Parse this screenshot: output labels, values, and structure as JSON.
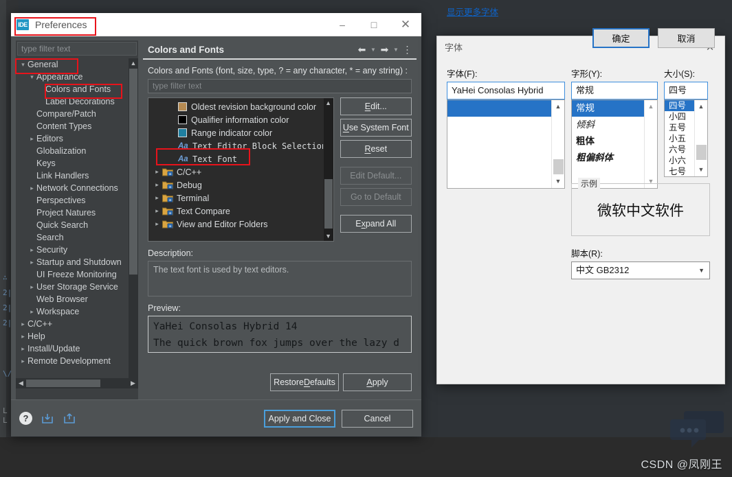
{
  "window": {
    "title": "Preferences",
    "badge": "IDE",
    "controls": {
      "minimize": "–",
      "maximize": "□",
      "close": "✕"
    }
  },
  "sidebar": {
    "filter_placeholder": "type filter text",
    "items": [
      {
        "label": "General",
        "indent": 0,
        "arrow": "down"
      },
      {
        "label": "Appearance",
        "indent": 1,
        "arrow": "down"
      },
      {
        "label": "Colors and Fonts",
        "indent": 2,
        "arrow": "none"
      },
      {
        "label": "Label Decorations",
        "indent": 2,
        "arrow": "none"
      },
      {
        "label": "Compare/Patch",
        "indent": 1,
        "arrow": "none"
      },
      {
        "label": "Content Types",
        "indent": 1,
        "arrow": "none"
      },
      {
        "label": "Editors",
        "indent": 1,
        "arrow": "right"
      },
      {
        "label": "Globalization",
        "indent": 1,
        "arrow": "none"
      },
      {
        "label": "Keys",
        "indent": 1,
        "arrow": "none"
      },
      {
        "label": "Link Handlers",
        "indent": 1,
        "arrow": "none"
      },
      {
        "label": "Network Connections",
        "indent": 1,
        "arrow": "right"
      },
      {
        "label": "Perspectives",
        "indent": 1,
        "arrow": "none"
      },
      {
        "label": "Project Natures",
        "indent": 1,
        "arrow": "none"
      },
      {
        "label": "Quick Search",
        "indent": 1,
        "arrow": "none"
      },
      {
        "label": "Search",
        "indent": 1,
        "arrow": "none"
      },
      {
        "label": "Security",
        "indent": 1,
        "arrow": "right"
      },
      {
        "label": "Startup and Shutdown",
        "indent": 1,
        "arrow": "right"
      },
      {
        "label": "UI Freeze Monitoring",
        "indent": 1,
        "arrow": "none"
      },
      {
        "label": "User Storage Service",
        "indent": 1,
        "arrow": "right"
      },
      {
        "label": "Web Browser",
        "indent": 1,
        "arrow": "none"
      },
      {
        "label": "Workspace",
        "indent": 1,
        "arrow": "right"
      },
      {
        "label": "C/C++",
        "indent": 0,
        "arrow": "right"
      },
      {
        "label": "Help",
        "indent": 0,
        "arrow": "right"
      },
      {
        "label": "Install/Update",
        "indent": 0,
        "arrow": "right"
      },
      {
        "label": "Remote Development",
        "indent": 0,
        "arrow": "right"
      }
    ]
  },
  "page": {
    "title": "Colors and Fonts",
    "filter_label": "Colors and Fonts (font, size, type, ? = any character, * = any string) :",
    "filter_placeholder": "type filter text",
    "tree": [
      {
        "label": "Oldest revision background color",
        "kind": "swatch",
        "color": "#b58a52",
        "indent": 1,
        "arrow": "none",
        "mono": false
      },
      {
        "label": "Qualifier information color",
        "kind": "swatch",
        "color": "#000000",
        "indent": 1,
        "arrow": "none",
        "mono": false
      },
      {
        "label": "Range indicator color",
        "kind": "swatch",
        "color": "#1f7fa0",
        "indent": 1,
        "arrow": "none",
        "mono": false
      },
      {
        "label": "Text Editor Block Selection Font",
        "kind": "aa",
        "color": "#6f9fd8",
        "indent": 1,
        "arrow": "none",
        "mono": true
      },
      {
        "label": "Text Font",
        "kind": "aa",
        "color": "#6f9fd8",
        "indent": 1,
        "arrow": "none",
        "mono": true
      },
      {
        "label": "C/C++",
        "kind": "folder",
        "color": "#d9a441",
        "indent": 0,
        "arrow": "right",
        "mono": false
      },
      {
        "label": "Debug",
        "kind": "folder",
        "color": "#d9a441",
        "indent": 0,
        "arrow": "right",
        "mono": false
      },
      {
        "label": "Terminal",
        "kind": "folder",
        "color": "#d9a441",
        "indent": 0,
        "arrow": "right",
        "mono": false
      },
      {
        "label": "Text Compare",
        "kind": "folder",
        "color": "#d9a441",
        "indent": 0,
        "arrow": "right",
        "mono": false
      },
      {
        "label": "View and Editor Folders",
        "kind": "folder",
        "color": "#d9a441",
        "indent": 0,
        "arrow": "right",
        "mono": false
      }
    ],
    "buttons": [
      {
        "label": "Edit...",
        "accel": "E",
        "disabled": false,
        "gap": false
      },
      {
        "label": "Use System Font",
        "accel": "U",
        "disabled": false,
        "gap": false
      },
      {
        "label": "Reset",
        "accel": "R",
        "disabled": false,
        "gap": false
      },
      {
        "label": "Edit Default...",
        "accel": "",
        "disabled": true,
        "gap": true
      },
      {
        "label": "Go to Default",
        "accel": "",
        "disabled": true,
        "gap": false
      },
      {
        "label": "Expand All",
        "accel": "x",
        "disabled": false,
        "gap": true
      }
    ],
    "description_label": "Description:",
    "description_text": "The text font is used by text editors.",
    "preview_label": "Preview:",
    "preview_lines": [
      "YaHei Consolas Hybrid 14",
      "The quick brown fox jumps over the lazy d"
    ],
    "restore_defaults": "Restore Defaults",
    "apply": "Apply",
    "toolbar_icons": [
      "back-arrow-icon",
      "back-dropdown-icon",
      "forward-arrow-icon",
      "forward-dropdown-icon",
      "view-menu-icon"
    ]
  },
  "footer": {
    "help": "?",
    "import_icon": "import-icon",
    "export_icon": "export-icon",
    "apply_and_close": "Apply and Close",
    "cancel": "Cancel"
  },
  "font_dialog": {
    "title": "字体",
    "close": "✕",
    "font_label": "字体(F):",
    "font_value": "YaHei Consolas Hybrid",
    "font_options": [
      ""
    ],
    "style_label": "字形(Y):",
    "style_value": "常规",
    "style_options": [
      {
        "text": "常规",
        "weight": "normal",
        "italic": false,
        "selected": true
      },
      {
        "text": "倾斜",
        "weight": "normal",
        "italic": true,
        "selected": false
      },
      {
        "text": "粗体",
        "weight": "bold",
        "italic": false,
        "selected": false
      },
      {
        "text": "粗偏斜体",
        "weight": "bold",
        "italic": true,
        "selected": false
      }
    ],
    "size_label": "大小(S):",
    "size_value": "四号",
    "size_options": [
      "四号",
      "小四",
      "五号",
      "小五",
      "六号",
      "小六",
      "七号"
    ],
    "sample_label": "示例",
    "sample_text": "微软中文软件",
    "script_label": "脚本(R):",
    "script_value": "中文 GB2312",
    "more_fonts_link": "显示更多字体",
    "ok": "确定",
    "cancel": "取消"
  },
  "watermark": {
    "text": "CSDN @凤刚王",
    "icon": "chat-bubble-icon"
  },
  "colors": {
    "accent_blue": "#2673c6",
    "annotation_red": "#e8131b",
    "panel_bg": "#4e5254",
    "tree_bg": "#2b2b2b",
    "dialog_bg": "#f0f0f0"
  },
  "background_code": [
    "∴",
    "2|",
    "2|",
    "2|",
    "\\/"
  ]
}
